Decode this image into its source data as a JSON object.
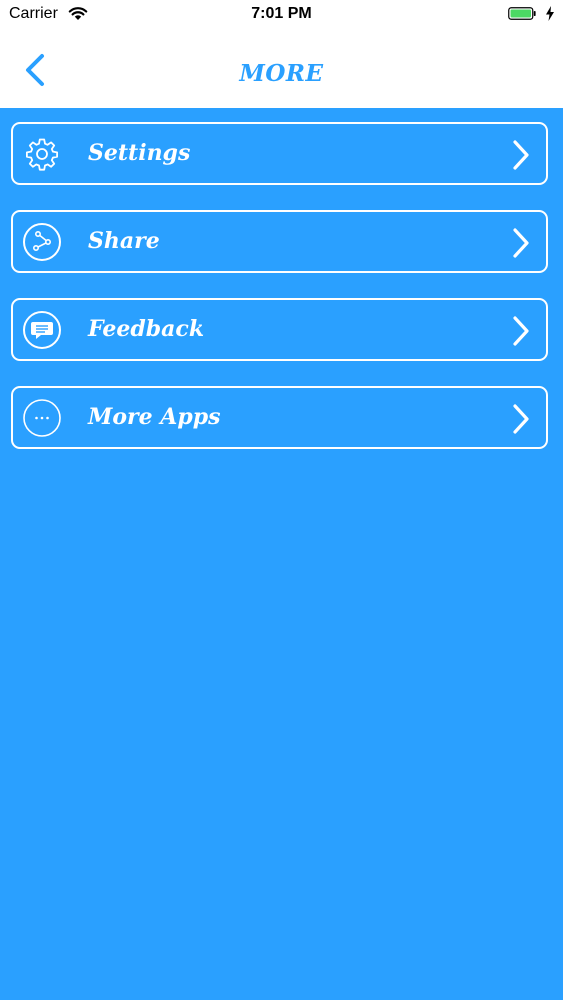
{
  "status_bar": {
    "carrier": "Carrier",
    "time": "7:01 PM"
  },
  "nav": {
    "title": "MORE",
    "back_icon": "chevron-left-icon"
  },
  "menu": {
    "items": [
      {
        "label": "Settings",
        "icon": "gear-icon"
      },
      {
        "label": "Share",
        "icon": "share-icon"
      },
      {
        "label": "Feedback",
        "icon": "chat-bubble-icon"
      },
      {
        "label": "More Apps",
        "icon": "ellipsis-icon"
      }
    ]
  },
  "colors": {
    "accent": "#2aa0ff",
    "background": "#2aa0ff",
    "nav_background": "#ffffff",
    "item_text": "#ffffff",
    "battery": "#4cd964"
  }
}
